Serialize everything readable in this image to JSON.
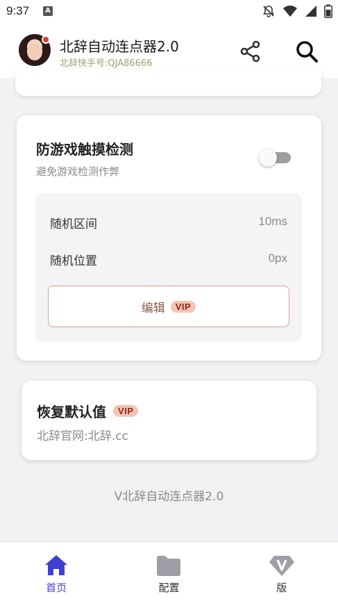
{
  "status": {
    "time": "9:37",
    "app_badge": "A"
  },
  "header": {
    "title": "北辞自动连点器2.0",
    "subtitle": "北辞快手号:QJA86666"
  },
  "anti_detect": {
    "title": "防游戏触摸检测",
    "description": "避免游戏检测作弊",
    "toggle_on": false,
    "rows": [
      {
        "label": "随机区间",
        "value": "10ms"
      },
      {
        "label": "随机位置",
        "value": "0px"
      }
    ],
    "edit_label": "编辑",
    "edit_badge": "VIP"
  },
  "reset": {
    "title": "恢复默认值",
    "badge": "VIP",
    "subtitle": "北辞官网:北辞.cc"
  },
  "footer": {
    "text": "V北辞自动连点器2.0"
  },
  "nav": {
    "items": [
      {
        "label": "首页",
        "icon": "home-icon",
        "active": true
      },
      {
        "label": "配置",
        "icon": "folder-icon",
        "active": false
      },
      {
        "label": "版",
        "icon": "diamond-v-icon",
        "active": false
      }
    ]
  },
  "colors": {
    "accent": "#3f3fd4",
    "vip_bg": "#f4c3b2",
    "vip_text": "#8a2a14",
    "subtitle": "#9aa36a"
  }
}
